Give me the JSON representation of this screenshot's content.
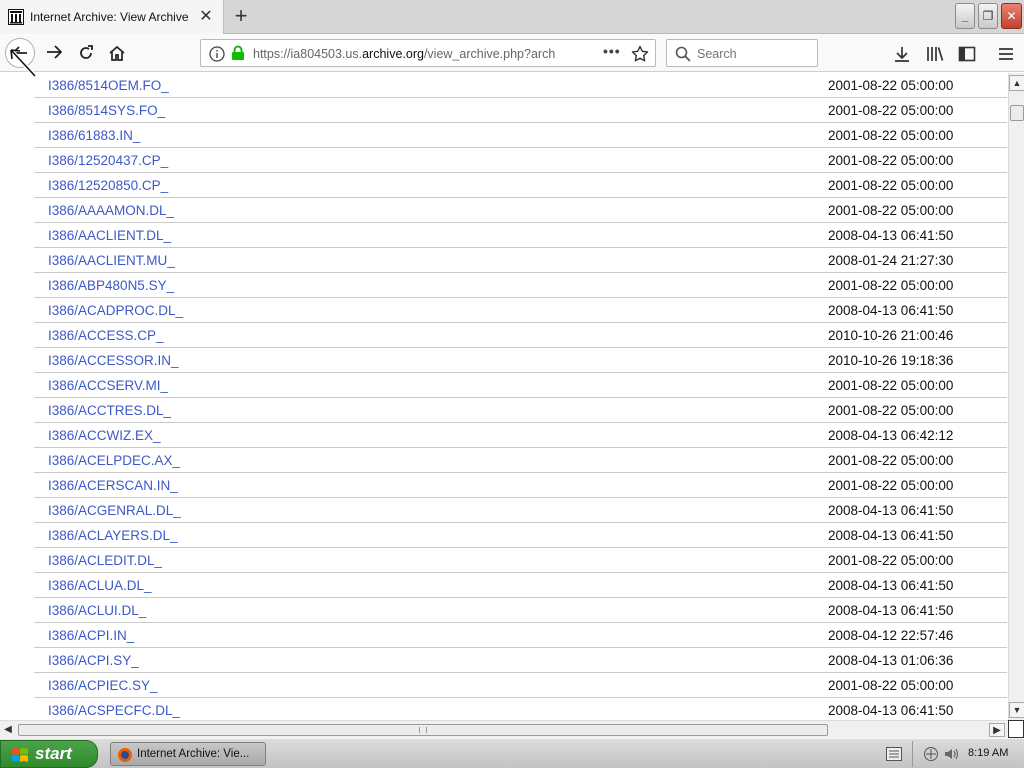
{
  "tab": {
    "title": "Internet Archive: View Archive"
  },
  "nav": {
    "url_prefix": "https://ia804503.us.",
    "url_host": "archive.org",
    "url_path": "/view_archive.php?arch",
    "search_placeholder": "Search"
  },
  "files": [
    {
      "name": "I386/8514OEM.FO_",
      "date": "2001-08-22 05:00:00"
    },
    {
      "name": "I386/8514SYS.FO_",
      "date": "2001-08-22 05:00:00"
    },
    {
      "name": "I386/61883.IN_",
      "date": "2001-08-22 05:00:00"
    },
    {
      "name": "I386/12520437.CP_",
      "date": "2001-08-22 05:00:00"
    },
    {
      "name": "I386/12520850.CP_",
      "date": "2001-08-22 05:00:00"
    },
    {
      "name": "I386/AAAAMON.DL_",
      "date": "2001-08-22 05:00:00"
    },
    {
      "name": "I386/AACLIENT.DL_",
      "date": "2008-04-13 06:41:50"
    },
    {
      "name": "I386/AACLIENT.MU_",
      "date": "2008-01-24 21:27:30"
    },
    {
      "name": "I386/ABP480N5.SY_",
      "date": "2001-08-22 05:00:00"
    },
    {
      "name": "I386/ACADPROC.DL_",
      "date": "2008-04-13 06:41:50"
    },
    {
      "name": "I386/ACCESS.CP_",
      "date": "2010-10-26 21:00:46"
    },
    {
      "name": "I386/ACCESSOR.IN_",
      "date": "2010-10-26 19:18:36"
    },
    {
      "name": "I386/ACCSERV.MI_",
      "date": "2001-08-22 05:00:00"
    },
    {
      "name": "I386/ACCTRES.DL_",
      "date": "2001-08-22 05:00:00"
    },
    {
      "name": "I386/ACCWIZ.EX_",
      "date": "2008-04-13 06:42:12"
    },
    {
      "name": "I386/ACELPDEC.AX_",
      "date": "2001-08-22 05:00:00"
    },
    {
      "name": "I386/ACERSCAN.IN_",
      "date": "2001-08-22 05:00:00"
    },
    {
      "name": "I386/ACGENRAL.DL_",
      "date": "2008-04-13 06:41:50"
    },
    {
      "name": "I386/ACLAYERS.DL_",
      "date": "2008-04-13 06:41:50"
    },
    {
      "name": "I386/ACLEDIT.DL_",
      "date": "2001-08-22 05:00:00"
    },
    {
      "name": "I386/ACLUA.DL_",
      "date": "2008-04-13 06:41:50"
    },
    {
      "name": "I386/ACLUI.DL_",
      "date": "2008-04-13 06:41:50"
    },
    {
      "name": "I386/ACPI.IN_",
      "date": "2008-04-12 22:57:46"
    },
    {
      "name": "I386/ACPI.SY_",
      "date": "2008-04-13 01:06:36"
    },
    {
      "name": "I386/ACPIEC.SY_",
      "date": "2001-08-22 05:00:00"
    },
    {
      "name": "I386/ACSPECFC.DL_",
      "date": "2008-04-13 06:41:50"
    }
  ],
  "taskbar": {
    "start_label": "start",
    "task_label": "Internet Archive: Vie...",
    "clock": "8:19 AM"
  },
  "colors": {
    "link": "#3d58c9",
    "start_green": "#2f8a2c"
  }
}
